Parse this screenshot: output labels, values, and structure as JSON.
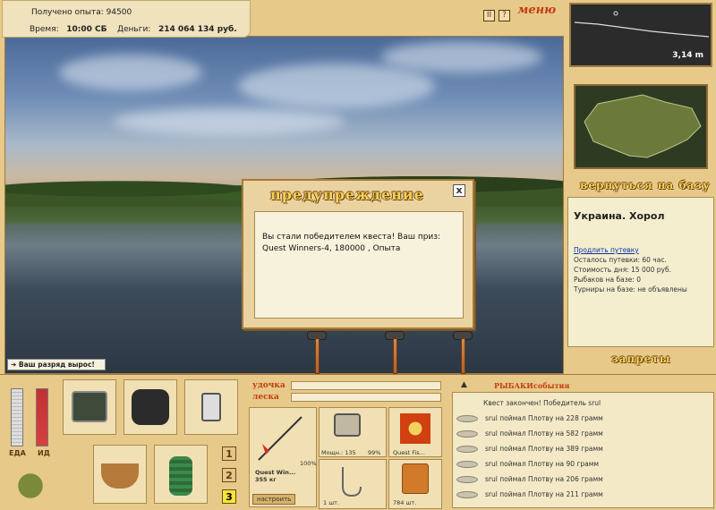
{
  "top_info": {
    "exp_label": "Получено опыта:",
    "exp_value": "94500",
    "time_label": "Время:",
    "time_value": "10:00 СБ",
    "money_label": "Деньги:",
    "money_value": "214 064 134 руб."
  },
  "menu": {
    "pause": "II",
    "help": "?",
    "label": "меню"
  },
  "depth": {
    "value": "3,14 m"
  },
  "return_label": "вернуться на базу",
  "location": {
    "title": "Украина. Хорол",
    "extend_link": "Продлить путевку",
    "lines": [
      "Осталось путевки: 60 час.",
      "Стоимость дня: 15 000 руб.",
      "Рыбаков на базе: 0",
      "Турниры на базе: не объявлены"
    ]
  },
  "bans_label": "запреты",
  "dialog": {
    "title": "предупреждение",
    "close": "x",
    "message": "Вы стали победителем квеста! Ваш приз: Quest Winners-4, 180000 , Опыта"
  },
  "rank_message": "Ваш разряд вырос!",
  "status": {
    "food": "ЕДА",
    "pd": "ИД"
  },
  "tackle": {
    "rod_label": "удочка",
    "line_label": "леска",
    "rod_name": "Quest Win...",
    "rod_weight": "355 кг",
    "rod_percent": "100%",
    "reel_info": "Мощн.: 135",
    "reel_percent": "99%",
    "line_name": "Quest Fis...",
    "hook_count": "1 шт.",
    "bait_count": "784 шт.",
    "tune_button": "настроить"
  },
  "slots": [
    "1",
    "2",
    "3"
  ],
  "events": {
    "header_a": "РЫБАКИ",
    "header_b": "события",
    "first": "Квест закончен! Победитель srul",
    "items": [
      "srul поймал Плотву на 228 грамм",
      "srul поймал Плотву на 582 грамм",
      "srul поймал Плотву на 389 грамм",
      "srul поймал Плотву на 90 грамм",
      "srul поймал Плотву на 206 грамм",
      "srul поймал Плотву на 211 грамм"
    ]
  },
  "colors": {
    "accent": "#c23d10",
    "gold": "#f2d25c",
    "wood": "#e7c98a"
  }
}
